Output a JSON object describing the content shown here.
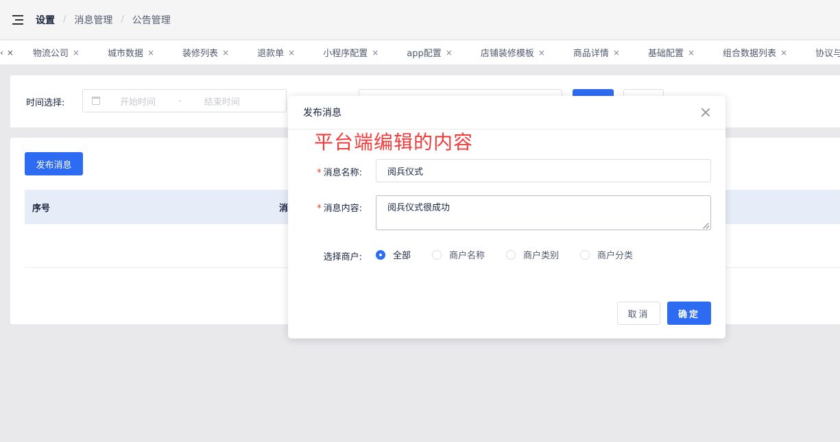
{
  "breadcrumb": {
    "items": [
      "设置",
      "消息管理",
      "公告管理"
    ],
    "separator": "/"
  },
  "tabs": [
    {
      "label": "物流公司"
    },
    {
      "label": "城市数据"
    },
    {
      "label": "装修列表"
    },
    {
      "label": "退款单"
    },
    {
      "label": "小程序配置"
    },
    {
      "label": "app配置"
    },
    {
      "label": "店铺装修模板"
    },
    {
      "label": "商品详情"
    },
    {
      "label": "基础配置"
    },
    {
      "label": "组合数据列表"
    },
    {
      "label": "协议与规"
    }
  ],
  "tab_close": "×",
  "tab_prev": "‹",
  "search": {
    "time_label": "时间选择:",
    "start_placeholder": "开始时间",
    "range_separator": "-",
    "end_placeholder": "结束时间"
  },
  "list": {
    "publish_label": "发布消息",
    "columns": [
      "序号",
      "消"
    ]
  },
  "modal": {
    "title": "发布消息",
    "annotation": "平台端编辑的内容",
    "name_label": "消息名称:",
    "name_value": "阅兵仪式",
    "content_label": "消息内容:",
    "content_value": "阅兵仪式很成功",
    "merchant_label": "选择商户:",
    "merchant_options": [
      {
        "label": "全部",
        "checked": true
      },
      {
        "label": "商户名称",
        "checked": false
      },
      {
        "label": "商户类别",
        "checked": false
      },
      {
        "label": "商户分类",
        "checked": false
      }
    ],
    "required_mark": "*",
    "cancel_label": "取消",
    "ok_label": "确定"
  },
  "colors": {
    "primary": "#2d6cf2",
    "annotation": "#f23c3c",
    "required": "#ed4014"
  }
}
